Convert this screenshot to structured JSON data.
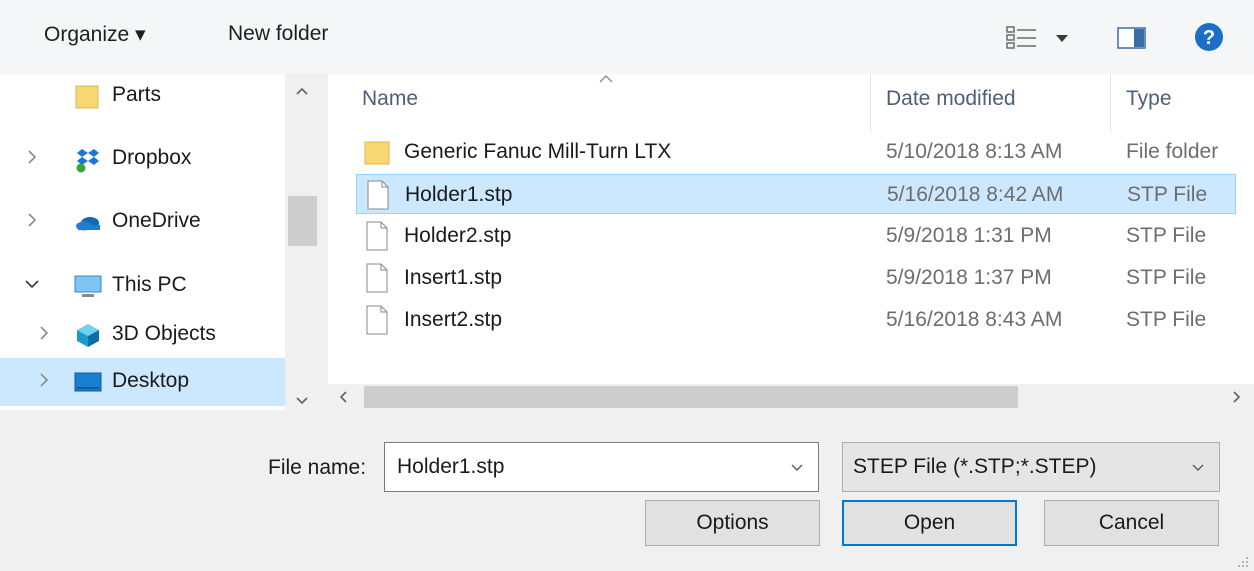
{
  "toolbar": {
    "organize_label": "Organize ▾",
    "new_folder_label": "New folder",
    "icons": [
      "view-options-icon",
      "preview-pane-icon",
      "help-icon"
    ]
  },
  "nav": {
    "items": [
      {
        "label": "Parts",
        "icon": "folder-icon",
        "chevron": "none"
      },
      {
        "label": "Dropbox",
        "icon": "dropbox-icon",
        "chevron": "collapsed"
      },
      {
        "label": "OneDrive",
        "icon": "onedrive-icon",
        "chevron": "collapsed"
      },
      {
        "label": "This PC",
        "icon": "computer-icon",
        "chevron": "expanded"
      },
      {
        "label": "3D Objects",
        "icon": "3d-objects-icon",
        "chevron": "collapsed"
      },
      {
        "label": "Desktop",
        "icon": "desktop-icon",
        "chevron": "collapsed",
        "selected": true
      }
    ]
  },
  "file_list": {
    "columns": {
      "name": "Name",
      "date": "Date modified",
      "type": "Type"
    },
    "rows": [
      {
        "name": "Generic Fanuc Mill-Turn LTX",
        "date": "5/10/2018 8:13 AM",
        "type": "File folder",
        "icon": "folder-icon"
      },
      {
        "name": "Holder1.stp",
        "date": "5/16/2018 8:42 AM",
        "type": "STP File",
        "icon": "file-icon",
        "selected": true
      },
      {
        "name": "Holder2.stp",
        "date": "5/9/2018 1:31 PM",
        "type": "STP File",
        "icon": "file-icon"
      },
      {
        "name": "Insert1.stp",
        "date": "5/9/2018 1:37 PM",
        "type": "STP File",
        "icon": "file-icon"
      },
      {
        "name": "Insert2.stp",
        "date": "5/16/2018 8:43 AM",
        "type": "STP File",
        "icon": "file-icon"
      }
    ]
  },
  "bottom": {
    "file_name_label": "File name:",
    "file_name_value": "Holder1.stp",
    "file_type_value": "STEP File (*.STP;*.STEP)",
    "options_label": "Options",
    "open_label": "Open",
    "cancel_label": "Cancel"
  },
  "colors": {
    "selection": "#cce8ff",
    "accent": "#0078d7",
    "help": "#1e6ec8"
  }
}
